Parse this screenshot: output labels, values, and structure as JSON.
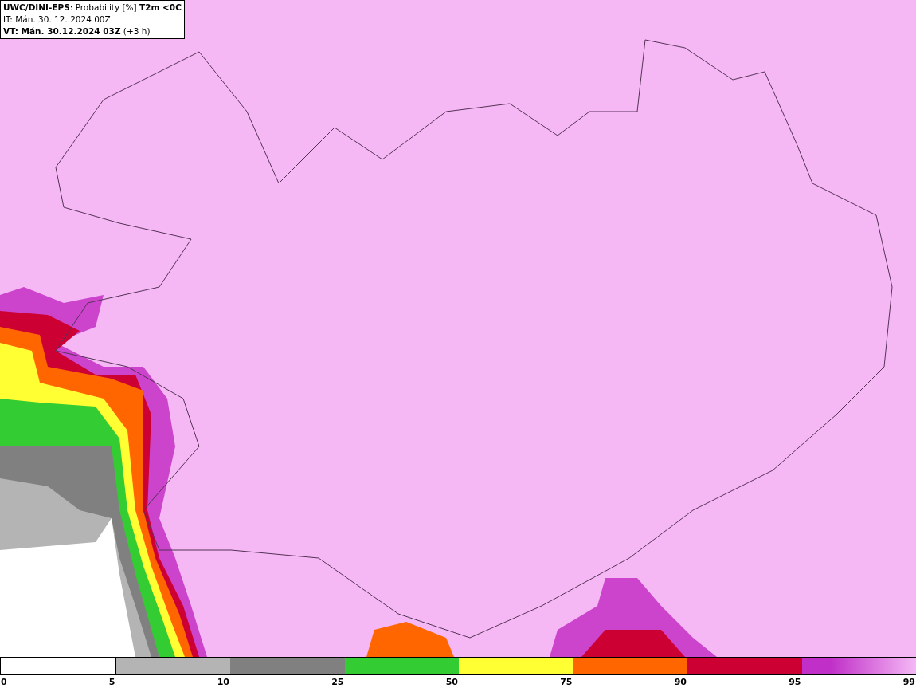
{
  "header": {
    "lines": [
      "**UWC/DINI-EPS**: Probability [%] **T2m <0C**",
      "IT: Mán. 30. 12. 2024 00Z",
      "**VT: Mán. 30.12.2024 03Z** (+3 h)"
    ]
  },
  "legend": {
    "segments": [
      {
        "color": "#ffffff"
      },
      {
        "color": "#b4b4b4"
      },
      {
        "color": "#808080"
      },
      {
        "color": "#33cc33"
      },
      {
        "color": "#ffff33"
      },
      {
        "color": "#ff6600"
      },
      {
        "color": "#cc0033"
      },
      {
        "color": "#c030c8"
      }
    ],
    "labels": [
      "0",
      "5",
      "10",
      "25",
      "50",
      "75",
      "90",
      "95",
      "99"
    ]
  }
}
